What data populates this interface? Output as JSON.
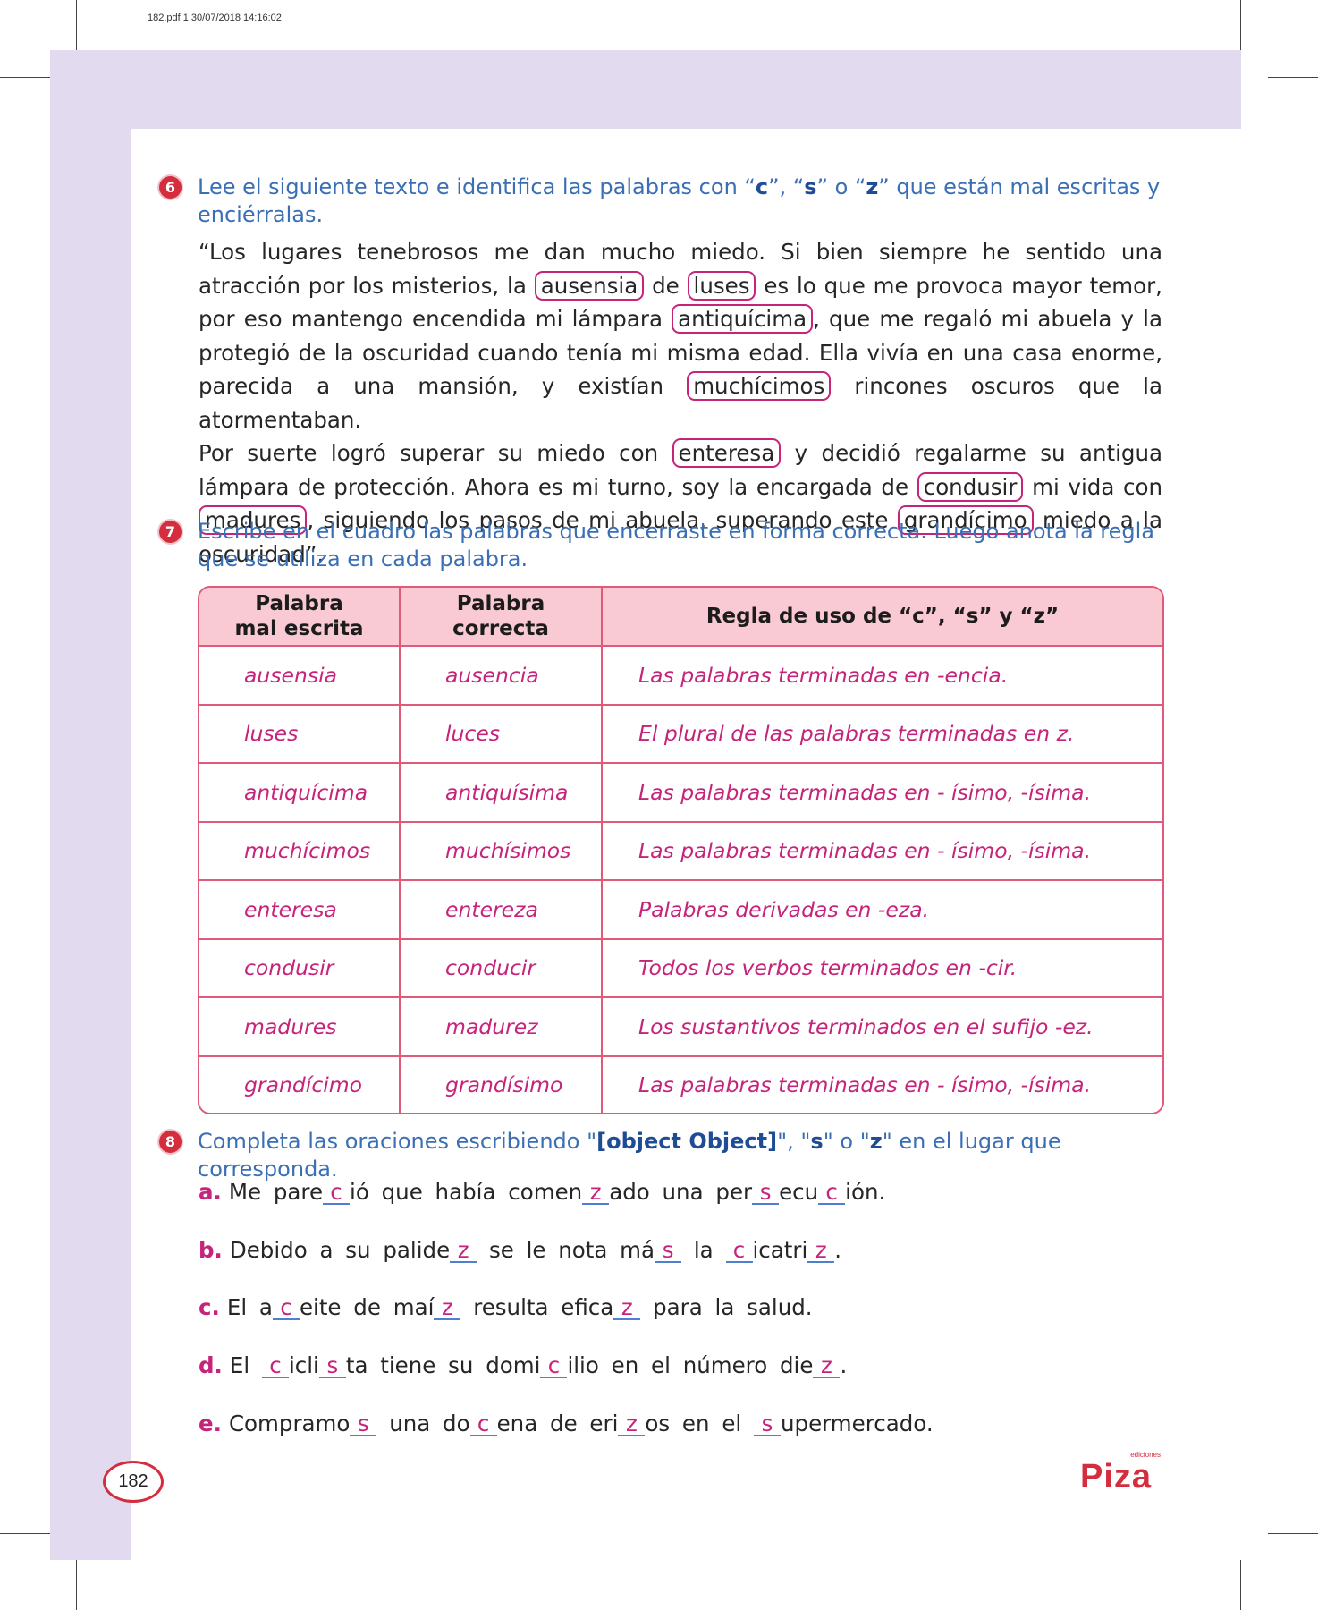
{
  "print_meta": "182.pdf  1  30/07/2018  14:16:02",
  "ex6": {
    "number": "6",
    "instr_pre": "Lee el siguiente texto e identifica las palabras con “",
    "c": "c",
    "sep1": "”, “",
    "s": "s",
    "sep2": "” o “",
    "z": "z",
    "instr_post": "” que están mal escritas y enciérralas.",
    "p1": "“Los lugares tenebrosos me dan mucho miedo. Si bien siempre he sentido una atracción por los misterios, la",
    "w1": "ausensia",
    "p2": "de",
    "w2": "luses",
    "p3": "es lo que me provoca mayor temor, por eso mantengo encendida mi lámpara",
    "w3": "antiquícima",
    "p4": ", que me regaló mi abuela y la protegió de la oscuridad cuando tenía mi misma edad. Ella vivía en una casa enorme, parecida a una mansión, y existían",
    "w4": "muchícimos",
    "p5": "rincones oscuros que la atormentaban.",
    "p6": "Por suerte logró superar su miedo con",
    "w5": "enteresa",
    "p7": "y decidió regalarme su antigua lámpara de protección. Ahora es mi turno, soy la encargada de",
    "w6": "condusir",
    "p8": "mi vida con",
    "w7": "madures",
    "p9": ", siguiendo los pasos de mi abuela, superando este",
    "w8": "grandícimo",
    "p10": "miedo a la oscuridad”."
  },
  "ex7": {
    "number": "7",
    "instr": "Escribe en el cuadro las palabras que encerraste en forma correcta. Luego anota la regla que se utiliza en cada palabra.",
    "headers": {
      "h1a": "Palabra",
      "h1b": "mal escrita",
      "h2a": "Palabra",
      "h2b": "correcta",
      "h3": "Regla de uso de “c”, “s” y “z”"
    },
    "rows": [
      {
        "wrong": "ausensia",
        "correct": "ausencia",
        "rule": "Las palabras terminadas en -encia."
      },
      {
        "wrong": "luses",
        "correct": "luces",
        "rule": "El plural de las palabras terminadas en z."
      },
      {
        "wrong": "antiquícima",
        "correct": "antiquísima",
        "rule": "Las palabras terminadas en - ísimo, -ísima."
      },
      {
        "wrong": "muchícimos",
        "correct": "muchísimos",
        "rule": "Las palabras terminadas en - ísimo, -ísima."
      },
      {
        "wrong": "enteresa",
        "correct": "entereza",
        "rule": "Palabras derivadas en -eza."
      },
      {
        "wrong": "condusir",
        "correct": "conducir",
        "rule": "Todos los verbos terminados en -cir."
      },
      {
        "wrong": "madures",
        "correct": "madurez",
        "rule": "Los sustantivos terminados en el sufijo -ez."
      },
      {
        "wrong": "grandícimo",
        "correct": "grandísimo",
        "rule": "Las palabras terminadas en - ísimo, -ísima."
      }
    ]
  },
  "ex8": {
    "number": "8",
    "instr_pre": "Completa las oraciones escribiendo \"",
    "c": {
      "letter": "c.",
      "t1": "El a",
      "b1": "c",
      "t2": "eite de maí",
      "b2": "z",
      "t3": "resulta efica",
      "b3": "z",
      "t4": "para la salud."
    },
    "sep1": "\", \"",
    "s": "s",
    "sep2": "\" o \"",
    "z": "z",
    "instr_post": "\" en el lugar que corresponda.",
    "a": {
      "letter": "a.",
      "t1": "Me pare",
      "b1": "c",
      "t2": "ió que había comen",
      "b2": "z",
      "t3": "ado una per",
      "b3": "s",
      "t4": "ecu",
      "b4": "c",
      "t5": "ión."
    },
    "b": {
      "letter": "b.",
      "t1": "Debido a su palide",
      "b1": "z",
      "t2": "se le nota má",
      "b2": "s",
      "t3": "la",
      "b3": "c",
      "t4": "icatri",
      "b4": "z",
      "t5": "."
    },
    "d": {
      "letter": "d.",
      "t1": "El",
      "b1": "c",
      "t2": "icli",
      "b2": "s",
      "t3": "ta tiene su domi",
      "b3": "c",
      "t4": "ilio en el número die",
      "b4": "z",
      "t5": "."
    },
    "e": {
      "letter": "e.",
      "t1": "Compramo",
      "b1": "s",
      "t2": "una do",
      "b2": "c",
      "t3": "ena de eri",
      "b3": "z",
      "t4": "os en el",
      "b4": "s",
      "t5": "upermercado."
    }
  },
  "page_number": "182",
  "logo": {
    "main": "Piza",
    "small": "ediciones"
  }
}
